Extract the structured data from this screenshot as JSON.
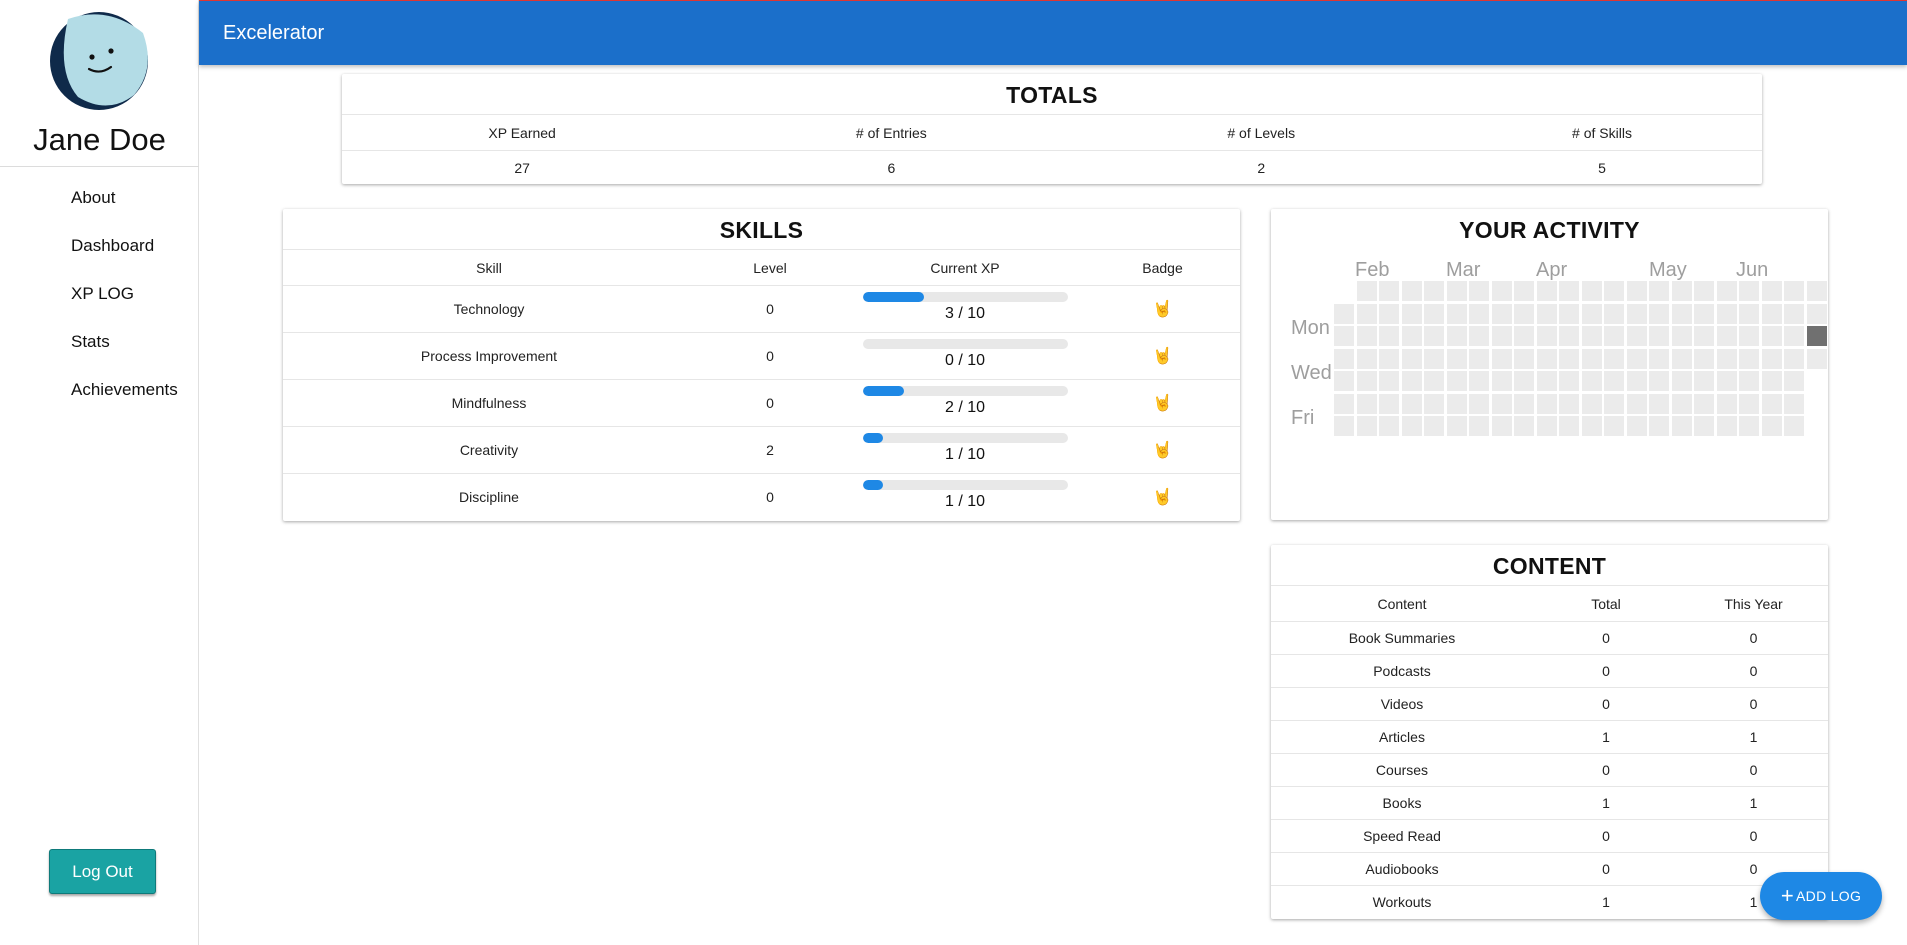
{
  "app": {
    "title": "Excelerator",
    "accent_color": "#1b6fca"
  },
  "user": {
    "name": "Jane Doe",
    "avatar_icon": "smiley-face-avatar"
  },
  "nav": [
    {
      "label": "About"
    },
    {
      "label": "Dashboard"
    },
    {
      "label": "XP LOG"
    },
    {
      "label": "Stats"
    },
    {
      "label": "Achievements"
    }
  ],
  "logout_label": "Log Out",
  "totals": {
    "title": "TOTALS",
    "headers": [
      "XP Earned",
      "# of Entries",
      "# of Levels",
      "# of Skills"
    ],
    "values": [
      "27",
      "6",
      "2",
      "5"
    ]
  },
  "skills": {
    "title": "SKILLS",
    "headers": [
      "Skill",
      "Level",
      "Current XP",
      "Badge"
    ],
    "rows": [
      {
        "skill": "Technology",
        "level": "0",
        "xp": "3 / 10",
        "progress": 0.3,
        "badge": "🤘"
      },
      {
        "skill": "Process Improvement",
        "level": "0",
        "xp": "0 / 10",
        "progress": 0.0,
        "badge": "🤘"
      },
      {
        "skill": "Mindfulness",
        "level": "0",
        "xp": "2 / 10",
        "progress": 0.2,
        "badge": "🤘"
      },
      {
        "skill": "Creativity",
        "level": "2",
        "xp": "1 / 10",
        "progress": 0.1,
        "badge": "🤘"
      },
      {
        "skill": "Discipline",
        "level": "0",
        "xp": "1 / 10",
        "progress": 0.1,
        "badge": "🤘"
      }
    ]
  },
  "activity": {
    "title": "YOUR ACTIVITY",
    "months": [
      "Feb",
      "Mar",
      "Apr",
      "May",
      "Jun"
    ],
    "day_labels": [
      "Mon",
      "Wed",
      "Fri"
    ],
    "active_color": "#707070",
    "empty_color": "#ebebeb"
  },
  "content": {
    "title": "CONTENT",
    "headers": [
      "Content",
      "Total",
      "This Year"
    ],
    "rows": [
      {
        "name": "Book Summaries",
        "total": "0",
        "year": "0"
      },
      {
        "name": "Podcasts",
        "total": "0",
        "year": "0"
      },
      {
        "name": "Videos",
        "total": "0",
        "year": "0"
      },
      {
        "name": "Articles",
        "total": "1",
        "year": "1"
      },
      {
        "name": "Courses",
        "total": "0",
        "year": "0"
      },
      {
        "name": "Books",
        "total": "1",
        "year": "1"
      },
      {
        "name": "Speed Read",
        "total": "0",
        "year": "0"
      },
      {
        "name": "Audiobooks",
        "total": "0",
        "year": "0"
      },
      {
        "name": "Workouts",
        "total": "1",
        "year": "1"
      }
    ]
  },
  "fab_label": "ADD LOG"
}
